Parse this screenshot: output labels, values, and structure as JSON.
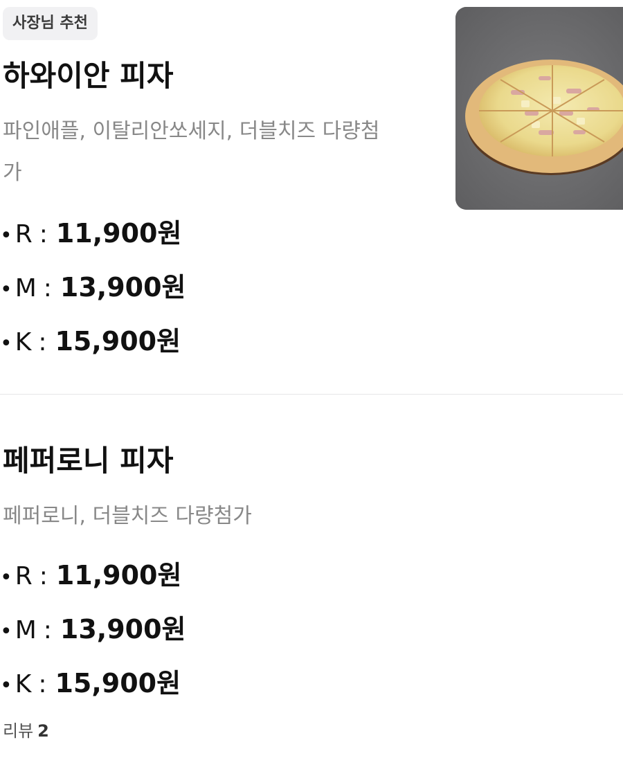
{
  "items": [
    {
      "badge": "사장님 추천",
      "name": "하와이안 피자",
      "description": "파인애플, 이탈리안쏘세지, 더블치즈 다량첨가",
      "prices": [
        {
          "size": "R",
          "price": "11,900원"
        },
        {
          "size": "M",
          "price": "13,900원"
        },
        {
          "size": "K",
          "price": "15,900원"
        }
      ],
      "image_icon": "pizza-photo"
    },
    {
      "name": "페퍼로니 피자",
      "description": "페퍼로니, 더블치즈 다량첨가",
      "prices": [
        {
          "size": "R",
          "price": "11,900원"
        },
        {
          "size": "M",
          "price": "13,900원"
        },
        {
          "size": "K",
          "price": "15,900원"
        }
      ],
      "review_label": "리뷰",
      "review_count": "2"
    }
  ],
  "bullet": "•",
  "colon": ":"
}
